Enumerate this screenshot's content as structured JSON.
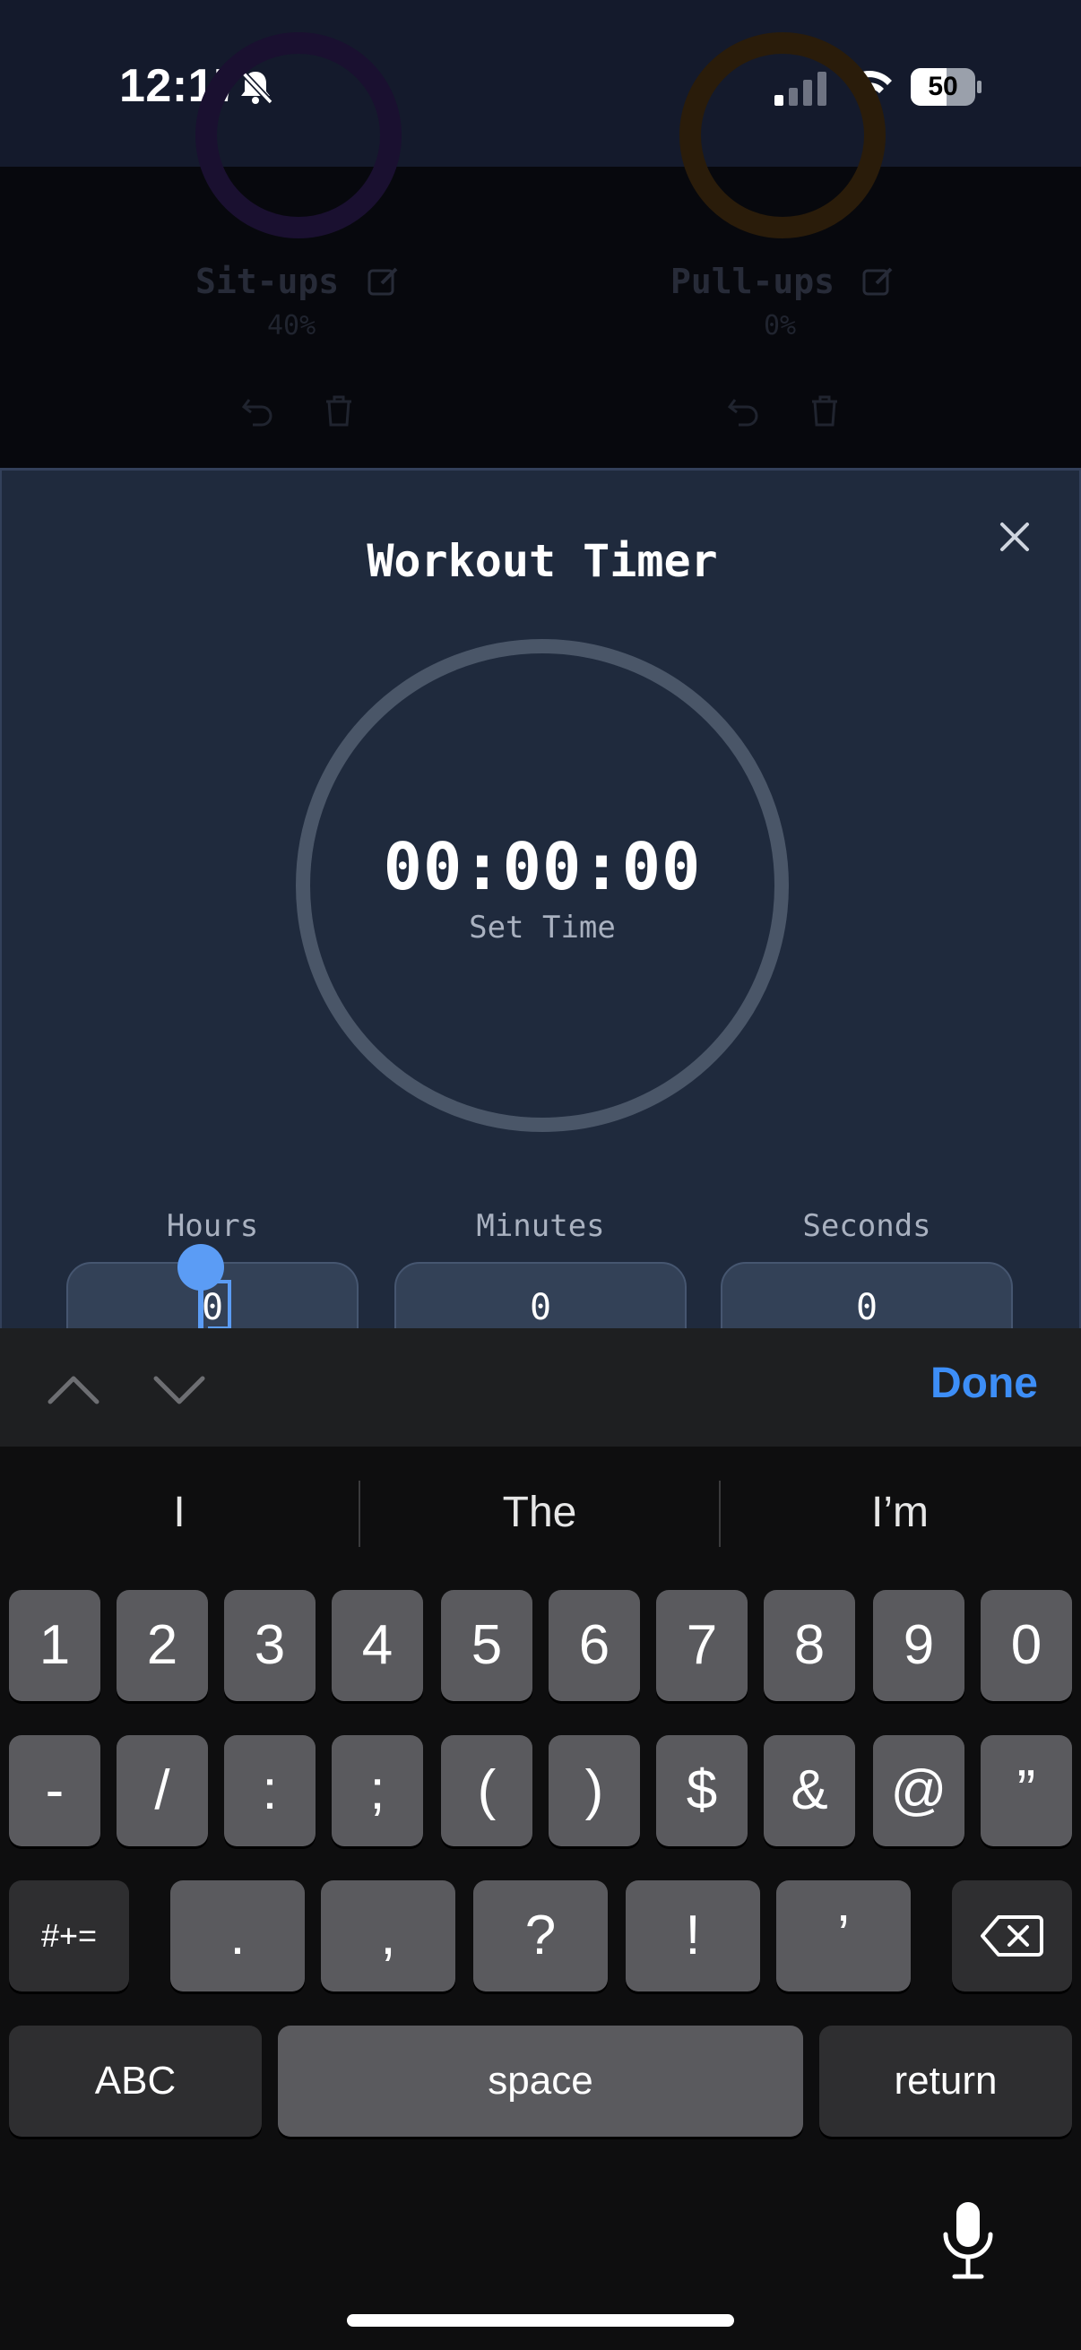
{
  "status_bar": {
    "time": "12:17",
    "battery": "50",
    "icons": [
      "bell-slash-icon",
      "signal-icon",
      "wifi-icon",
      "battery-icon"
    ]
  },
  "background": {
    "cards": [
      {
        "label": "Sit-ups",
        "percent": "40%",
        "ring_color": "#5b2a8c"
      },
      {
        "label": "Pull-ups",
        "percent": "0%",
        "ring_color": "#8c5a1a"
      }
    ]
  },
  "modal": {
    "title": "Workout Timer",
    "timer": "00:00:00",
    "timer_sub": "Set Time",
    "fields": [
      {
        "label": "Hours",
        "value": "0"
      },
      {
        "label": "Minutes",
        "value": "0"
      },
      {
        "label": "Seconds",
        "value": "0"
      }
    ]
  },
  "accessory": {
    "done": "Done"
  },
  "keyboard": {
    "suggestions": [
      "I",
      "The",
      "I’m"
    ],
    "row1": [
      "1",
      "2",
      "3",
      "4",
      "5",
      "6",
      "7",
      "8",
      "9",
      "0"
    ],
    "row2": [
      "-",
      "/",
      ":",
      ";",
      "(",
      ")",
      "$",
      "&",
      "@",
      "”"
    ],
    "row3": [
      "#+=",
      ".",
      ",",
      "?",
      "!",
      "’"
    ],
    "abc": "ABC",
    "space": "space",
    "return": "return"
  },
  "colors": {
    "accent": "#3d8ef7",
    "modal_bg": "#1f2a3d",
    "ring": "#4a5668"
  }
}
